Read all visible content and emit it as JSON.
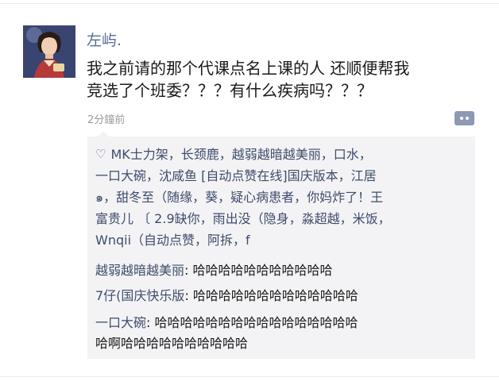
{
  "post": {
    "nickname": "左屿.",
    "text_line1": "我之前请的那个代课点名上课的人 还顺便帮我",
    "text_line2": "竞选了个班委？？？有什么疾病吗？？？",
    "timestamp": "2分鐘前",
    "more_icon": "more-dots-icon"
  },
  "likes": {
    "icon": "heart-outline-icon",
    "line1": "MK士力架，长颈鹿，越弱越暗越美丽，口水，",
    "line2": "一口大碗，沈咸鱼 [自动点赞在线]国庆版本，江居",
    "line3": "๑，甜冬至（随缘，葵，疑心病患者，你妈炸了！王",
    "line4": "富贵儿 〔 2.9缺你，雨出没（隐身，淼超越，米饭，",
    "line5": "Wnqii（自动点赞，阿拆，f"
  },
  "comments": [
    {
      "author": "越弱越暗越美丽",
      "text_line1": "哈哈哈哈哈哈哈哈哈哈哈",
      "text_line2": ""
    },
    {
      "author": "7仔(国庆快乐版",
      "text_line1": "哈哈哈哈哈哈哈哈哈哈哈哈哈",
      "text_line2": ""
    },
    {
      "author": "一口大碗",
      "text_line1": "哈哈哈哈哈哈哈哈哈哈哈哈哈哈哈哈",
      "text_line2": "哈啊哈哈哈哈哈哈哈哈哈哈"
    }
  ],
  "colors": {
    "name_blue": "#586b95",
    "comment_bg": "#f3f3f5",
    "text": "#1a1a1a",
    "muted": "#9a9a9a"
  }
}
